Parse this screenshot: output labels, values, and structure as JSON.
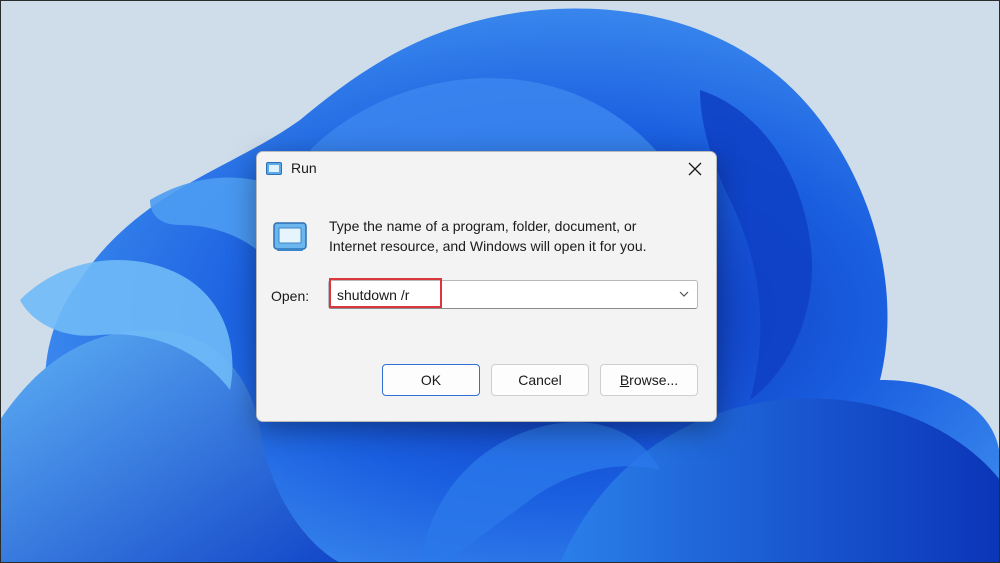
{
  "dialog": {
    "title": "Run",
    "description_line1": "Type the name of a program, folder, document, or",
    "description_line2": "Internet resource, and Windows will open it for you.",
    "open_label": "Open:",
    "open_value": "shutdown /r",
    "buttons": {
      "ok": "OK",
      "cancel": "Cancel",
      "browse_mnemonic": "B",
      "browse_rest": "rowse..."
    },
    "icons": {
      "title": "run-icon",
      "big": "run-icon",
      "close": "close-icon",
      "dropdown": "chevron-down-icon"
    }
  },
  "colors": {
    "wallpaper_bg": "#cfdcea",
    "accent_blue": "#1a5fe0",
    "highlight_red": "#d9363e",
    "default_button_border": "#2f6fd6"
  }
}
